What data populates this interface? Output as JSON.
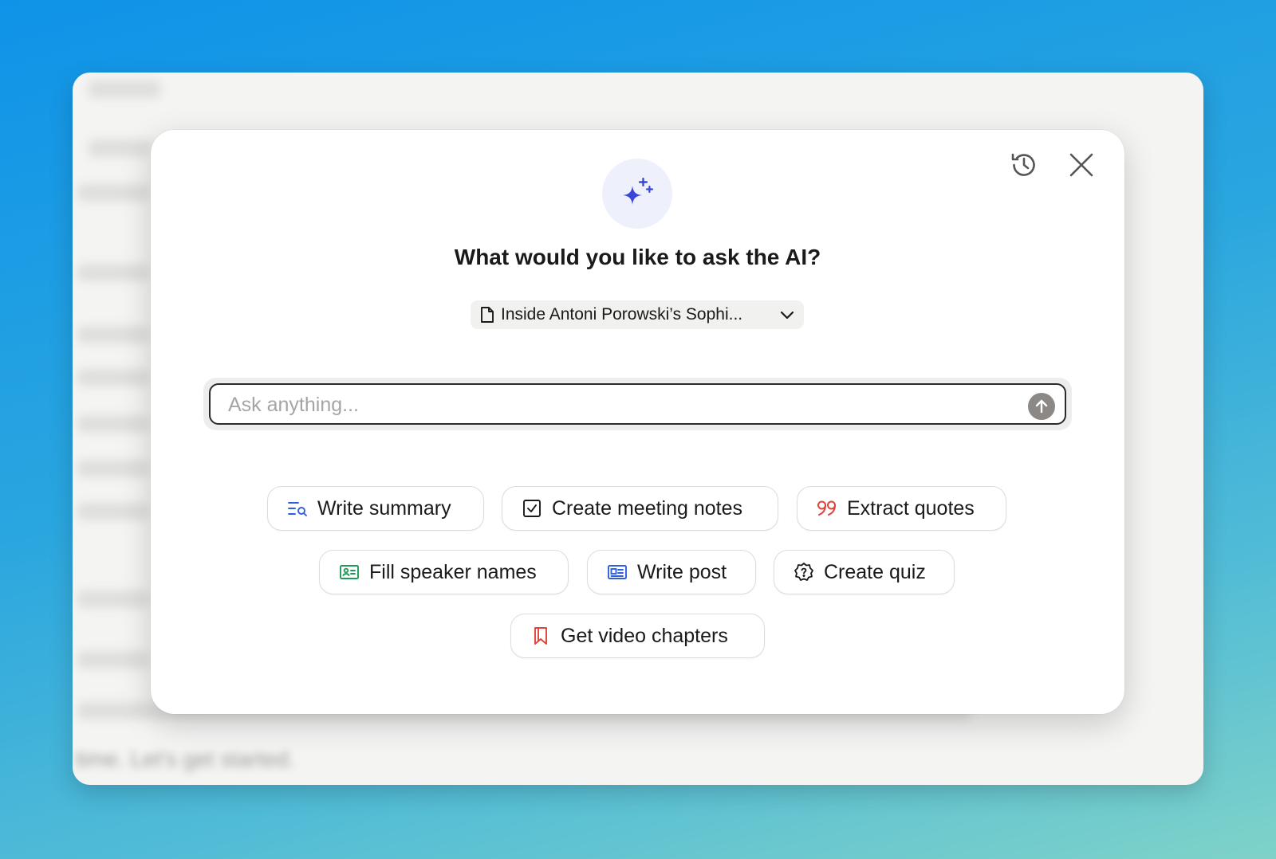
{
  "modal": {
    "title": "What would you like to ask the AI?",
    "document_selector": {
      "label": "Inside Antoni Porowski’s Sophi...",
      "icon": "document-icon"
    },
    "header_actions": [
      {
        "name": "history",
        "icon": "history-icon"
      },
      {
        "name": "close",
        "icon": "close-icon"
      }
    ],
    "input": {
      "placeholder": "Ask anything...",
      "value": "",
      "send_icon": "arrow-up-icon"
    },
    "actions": [
      {
        "label": "Write summary",
        "icon": "summary-icon",
        "color": "#2f5fe0"
      },
      {
        "label": "Create meeting notes",
        "icon": "checkbox-icon",
        "color": "#1a1a1a"
      },
      {
        "label": "Extract quotes",
        "icon": "quote-icon",
        "color": "#e0433a"
      },
      {
        "label": "Fill speaker names",
        "icon": "id-card-icon",
        "color": "#1e9a5a"
      },
      {
        "label": "Write post",
        "icon": "newspaper-icon",
        "color": "#2f5fe0"
      },
      {
        "label": "Create quiz",
        "icon": "help-badge-icon",
        "color": "#1a1a1a"
      },
      {
        "label": "Get video chapters",
        "icon": "bookmark-icon",
        "color": "#e0433a"
      }
    ]
  },
  "background_text": "time. Let's get started.",
  "colors": {
    "accent_sparkle": "#3b45d9",
    "sparkle_badge_bg": "#eef1fb",
    "send_button": "#8c8886"
  }
}
